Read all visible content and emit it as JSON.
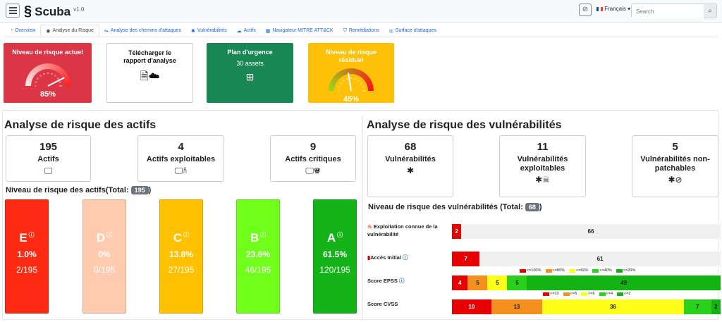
{
  "header": {
    "app_name": "Scuba",
    "version": "v1.0",
    "language": "Français",
    "search_placeholder": "Search"
  },
  "tabs": [
    {
      "label": "Overview",
      "icon": "gauge-icon",
      "active": false
    },
    {
      "label": "Analyse du Risque",
      "icon": "dashboard-icon",
      "active": true
    },
    {
      "label": "Analyse des chemins d'attaques",
      "icon": "route-icon",
      "active": false
    },
    {
      "label": "Vulnérabilités",
      "icon": "bug-icon",
      "active": false
    },
    {
      "label": "Actifs",
      "icon": "cloud-icon",
      "active": false
    },
    {
      "label": "Navigateur MITRE ATT&CK",
      "icon": "map-icon",
      "active": false
    },
    {
      "label": "Remédiations",
      "icon": "shield-icon",
      "active": false
    },
    {
      "label": "Surface d'attaques",
      "icon": "radar-icon",
      "active": false
    }
  ],
  "top_cards": {
    "current_risk": {
      "title": "Niveau de risque actuel",
      "value": "85%",
      "gauge": 0.85
    },
    "download": {
      "title": "Télécharger le rapport d'analyse"
    },
    "emergency": {
      "title": "Plan d'urgence",
      "subtitle": "30 assets"
    },
    "residual_risk": {
      "title": "Niveau de risque résiduel",
      "value": "45%",
      "gauge": 0.45
    }
  },
  "gauge_ticks": [
    "0",
    "10",
    "20",
    "30",
    "40",
    "50",
    "60",
    "70",
    "80",
    "90",
    "100"
  ],
  "assets": {
    "heading": "Analyse de risque des actifs",
    "stats": [
      {
        "num": "195",
        "label": "Actifs"
      },
      {
        "num": "4",
        "label": "Actifs exploitables"
      },
      {
        "num": "9",
        "label": "Actifs critiques"
      }
    ],
    "level_title": "Niveau de risque des actifs(Total:",
    "total": "195",
    "grades": [
      {
        "letter": "E",
        "pct": "1.0%",
        "count": "2/195",
        "color": "#ff2a12"
      },
      {
        "letter": "D",
        "pct": "0%",
        "count": "0/195",
        "color": "#ffcbb0"
      },
      {
        "letter": "C",
        "pct": "13.8%",
        "count": "27/195",
        "color": "#ffc000"
      },
      {
        "letter": "B",
        "pct": "23.6%",
        "count": "46/195",
        "color": "#70ff1a"
      },
      {
        "letter": "A",
        "pct": "61.5%",
        "count": "120/195",
        "color": "#15b31a"
      }
    ]
  },
  "vulns": {
    "heading": "Analyse de risque des vulnérabilités",
    "stats": [
      {
        "num": "68",
        "label": "Vulnérabilités"
      },
      {
        "num": "11",
        "label": "Vulnérabilités exploitables"
      },
      {
        "num": "5",
        "label": "Vulnérabilités non-patchables"
      }
    ],
    "level_title": "Niveau de risque des vulnérabilités (Total:",
    "total": "68",
    "rows": [
      {
        "label": "Exploitation connue de la vulnérabilité",
        "segments": [
          {
            "value": 2,
            "text": "2",
            "color": "#e60000"
          },
          {
            "value": 66,
            "text": "66",
            "color": "#f0f0f0"
          }
        ]
      },
      {
        "label": "Accès Initial",
        "segments": [
          {
            "value": 7,
            "text": "7",
            "color": "#e60000"
          },
          {
            "value": 61,
            "text": "61",
            "color": "#f0f0f0"
          }
        ]
      },
      {
        "label": "Score EPSS",
        "segments": [
          {
            "value": 4,
            "text": "4",
            "color": "#e60000"
          },
          {
            "value": 5,
            "text": "5",
            "color": "#f5901e"
          },
          {
            "value": 5,
            "text": "5",
            "color": "#ffff1a"
          },
          {
            "value": 5,
            "text": "5",
            "color": "#2ad11a"
          },
          {
            "value": 49,
            "text": "49",
            "color": "#12b312"
          }
        ]
      },
      {
        "label": "Score CVSS",
        "segments": [
          {
            "value": 10,
            "text": "10",
            "color": "#e60000"
          },
          {
            "value": 13,
            "text": "13",
            "color": "#f5901e"
          },
          {
            "value": 36,
            "text": "36",
            "color": "#ffff1a"
          },
          {
            "value": 7,
            "text": "7",
            "color": "#2ad11a"
          },
          {
            "value": 2,
            "text": "2",
            "color": "#12b312"
          }
        ]
      }
    ],
    "legend_epss": [
      "<=100%",
      "<=80%",
      "<=60%",
      "<=40%",
      "<=20%"
    ],
    "legend_cvss": [
      "<=10",
      "<=8",
      "<=6",
      "<=4",
      "<=2"
    ],
    "legend_colors": [
      "#e60000",
      "#f5901e",
      "#ffff1a",
      "#2ad11a",
      "#12b312"
    ]
  }
}
